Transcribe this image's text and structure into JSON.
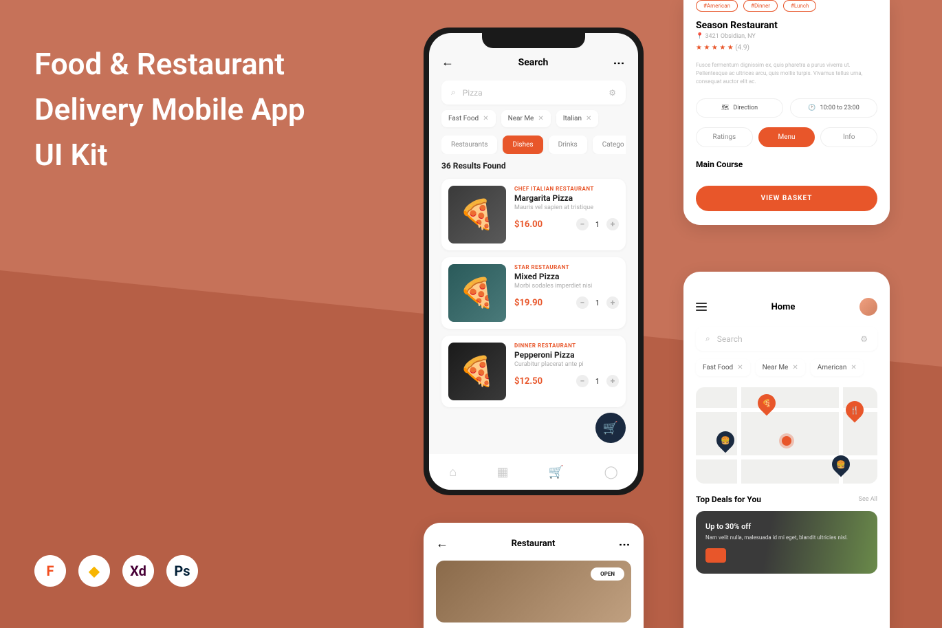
{
  "promo": {
    "title": "Food & Restaurant Delivery Mobile App UI Kit"
  },
  "tools": [
    "F",
    "◆",
    "Xd",
    "Ps"
  ],
  "search_screen": {
    "title": "Search",
    "search_placeholder": "Pizza",
    "filters": [
      {
        "label": "Fast Food"
      },
      {
        "label": "Near Me"
      },
      {
        "label": "Italian"
      }
    ],
    "categories": [
      {
        "label": "Restaurants",
        "active": false
      },
      {
        "label": "Dishes",
        "active": true
      },
      {
        "label": "Drinks",
        "active": false
      },
      {
        "label": "Catego",
        "active": false
      }
    ],
    "results_label": "36 Results Found",
    "dishes": [
      {
        "restaurant": "CHEF ITALIAN RESTAURANT",
        "name": "Margarita Pizza",
        "desc": "Mauris vel sapien at tristique",
        "price": "$16.00",
        "qty": "1"
      },
      {
        "restaurant": "STAR RESTAURANT",
        "name": "Mixed Pizza",
        "desc": "Morbi sodales imperdiet nisi",
        "price": "$19.90",
        "qty": "1"
      },
      {
        "restaurant": "DINNER RESTAURANT",
        "name": "Pepperoni Pizza",
        "desc": "Curabitur placerat ante pi",
        "price": "$12.50",
        "qty": "1"
      }
    ]
  },
  "restaurant_detail": {
    "tags": [
      "#American",
      "#Dinner",
      "#Lunch"
    ],
    "name": "Season Restaurant",
    "address": "3421 Obsidian, NY",
    "stars": "★ ★ ★ ★ ★",
    "rating": "(4.9)",
    "description": "Fusce fermentum dignissim ex, quis pharetra a purus viverra ut. Pellentesque ac ultrices arcu, quis mollis turpis. Vivamus tellus urna, consequat auctor elit ac.",
    "direction_label": "Direction",
    "hours_label": "10:00 to 23:00",
    "tabs": [
      {
        "label": "Ratings",
        "active": false
      },
      {
        "label": "Menu",
        "active": true
      },
      {
        "label": "Info",
        "active": false
      }
    ],
    "section": "Main Course",
    "basket_label": "VIEW BASKET"
  },
  "home_screen": {
    "title": "Home",
    "search_placeholder": "Search",
    "filters": [
      {
        "label": "Fast Food"
      },
      {
        "label": "Near Me"
      },
      {
        "label": "American"
      }
    ],
    "deals_title": "Top Deals for You",
    "see_all": "See All",
    "deal": {
      "title": "Up to 30% off",
      "desc": "Nam velit nulla, malesuada id mi eget, blandit ultricies nisl."
    }
  },
  "restaurant_screen": {
    "title": "Restaurant",
    "status": "OPEN"
  }
}
